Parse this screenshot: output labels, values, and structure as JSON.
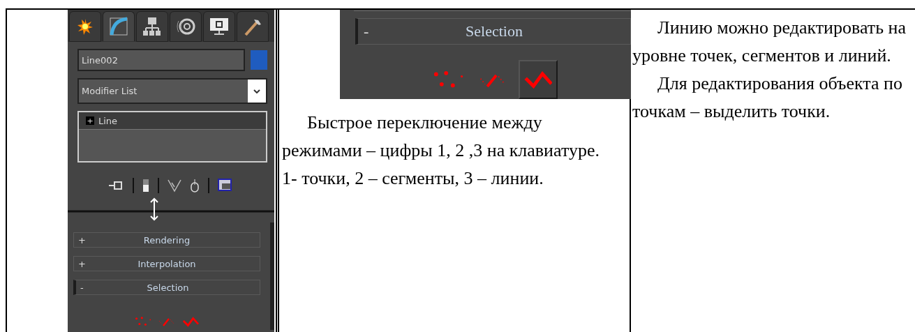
{
  "panel": {
    "tabs": [
      {
        "kind": "create",
        "selected": false
      },
      {
        "kind": "modify",
        "selected": true
      },
      {
        "kind": "hierarchy",
        "selected": false
      },
      {
        "kind": "motion",
        "selected": false
      },
      {
        "kind": "display",
        "selected": false
      },
      {
        "kind": "utilities",
        "selected": false
      }
    ],
    "object_name": "Line002",
    "modifier_list": "Modifier List",
    "stack": [
      {
        "sign": "+",
        "label": "Line"
      }
    ],
    "rollouts": [
      {
        "sign": "+",
        "label": "Rendering",
        "expanded": false
      },
      {
        "sign": "+",
        "label": "Interpolation",
        "expanded": false
      },
      {
        "sign": "-",
        "label": "Selection",
        "expanded": true
      }
    ],
    "selection_levels": [
      {
        "kind": "vertex",
        "selected": false
      },
      {
        "kind": "segment",
        "selected": false
      },
      {
        "kind": "spline",
        "selected": false
      }
    ]
  },
  "closeup": {
    "rollout": {
      "sign": "-",
      "label": "Selection",
      "expanded": true
    },
    "selection_levels": [
      {
        "kind": "vertex",
        "selected": false
      },
      {
        "kind": "segment",
        "selected": false
      },
      {
        "kind": "spline",
        "selected": true
      }
    ]
  },
  "middle_text": "Быстрое переключение между режимами – цифры 1, 2 ,3 на клавиатуре. 1- точки, 2 – сегменты, 3 – линии.",
  "right_paragraphs": [
    "Линию можно редактировать на уровне точек, сегментов и линий.",
    "Для редактирования объекта по точкам – выделить точки."
  ]
}
